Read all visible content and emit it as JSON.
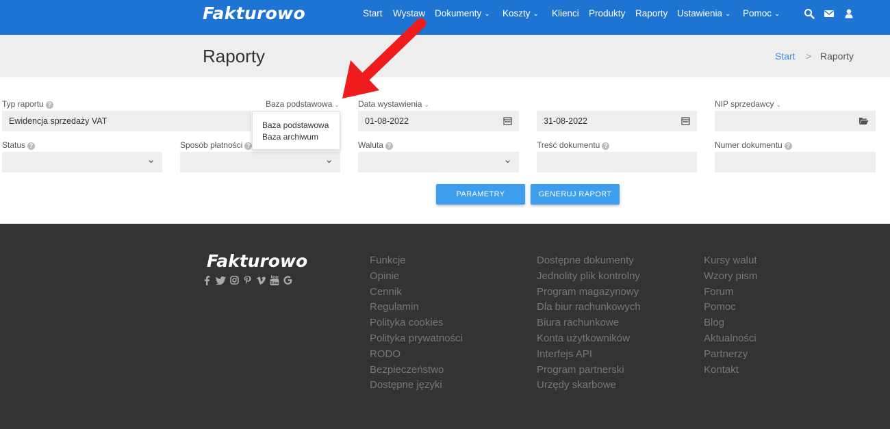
{
  "header": {
    "logo": "Fakturowo",
    "nav": [
      {
        "label": "Start",
        "dropdown": false
      },
      {
        "label": "Wystaw",
        "dropdown": false
      },
      {
        "label": "Dokumenty",
        "dropdown": true
      },
      {
        "label": "Koszty",
        "dropdown": true
      },
      {
        "label": "Klienci",
        "dropdown": false
      },
      {
        "label": "Produkty",
        "dropdown": false
      },
      {
        "label": "Raporty",
        "dropdown": false
      },
      {
        "label": "Ustawienia",
        "dropdown": true
      },
      {
        "label": "Pomoc",
        "dropdown": true
      }
    ],
    "icons": [
      "search-icon",
      "envelope-icon",
      "user-icon"
    ]
  },
  "title_band": {
    "title": "Raporty",
    "breadcrumb": {
      "start": "Start",
      "separator": ">",
      "current": "Raporty"
    }
  },
  "form": {
    "typ_raportu": {
      "label": "Typ raportu",
      "value": "Ewidencja sprzedaży VAT"
    },
    "baza": {
      "label": "Baza podstawowa",
      "options": [
        "Baza podstawowa",
        "Baza archiwum"
      ]
    },
    "data_wystawienia": {
      "label": "Data wystawienia",
      "from": "01-08-2022",
      "to": "31-08-2022"
    },
    "nip_sprzedawcy": {
      "label": "NIP sprzedawcy",
      "value": ""
    },
    "status": {
      "label": "Status",
      "value": ""
    },
    "sposob_platnosci": {
      "label": "Sposób płatności",
      "value": ""
    },
    "waluta": {
      "label": "Waluta",
      "value": ""
    },
    "tresc_dokumentu": {
      "label": "Treść dokumentu",
      "value": ""
    },
    "numer_dokumentu": {
      "label": "Numer dokumentu",
      "value": ""
    },
    "buttons": {
      "parametry": "PARAMETRY",
      "generuj": "GENERUJ RAPORT"
    }
  },
  "annotation": {
    "arrow_color": "#ee1c1c"
  },
  "footer": {
    "logo": "Fakturowo",
    "social": [
      "facebook-icon",
      "twitter-icon",
      "instagram-icon",
      "pinterest-icon",
      "vimeo-icon",
      "youtube-icon",
      "google-icon"
    ],
    "col1": [
      "Funkcje",
      "Opinie",
      "Cennik",
      "Regulamin",
      "Polityka cookies",
      "Polityka prywatności",
      "RODO",
      "Bezpieczeństwo",
      "Dostępne języki"
    ],
    "col2": [
      "Dostępne dokumenty",
      "Jednolity plik kontrolny",
      "Program magazynowy",
      "Dla biur rachunkowych",
      "Biura rachunkowe",
      "Konta użytkowników",
      "Interfejs API",
      "Program partnerski",
      "Urzędy skarbowe"
    ],
    "col3": [
      "Kursy walut",
      "Wzory pism",
      "Forum",
      "Pomoc",
      "Blog",
      "Aktualności",
      "Partnerzy",
      "Kontakt"
    ]
  },
  "colors": {
    "primary": "#1e74d2",
    "button": "#3d9ef0",
    "footer_bg": "#333333",
    "band_bg": "#eeeeee"
  }
}
